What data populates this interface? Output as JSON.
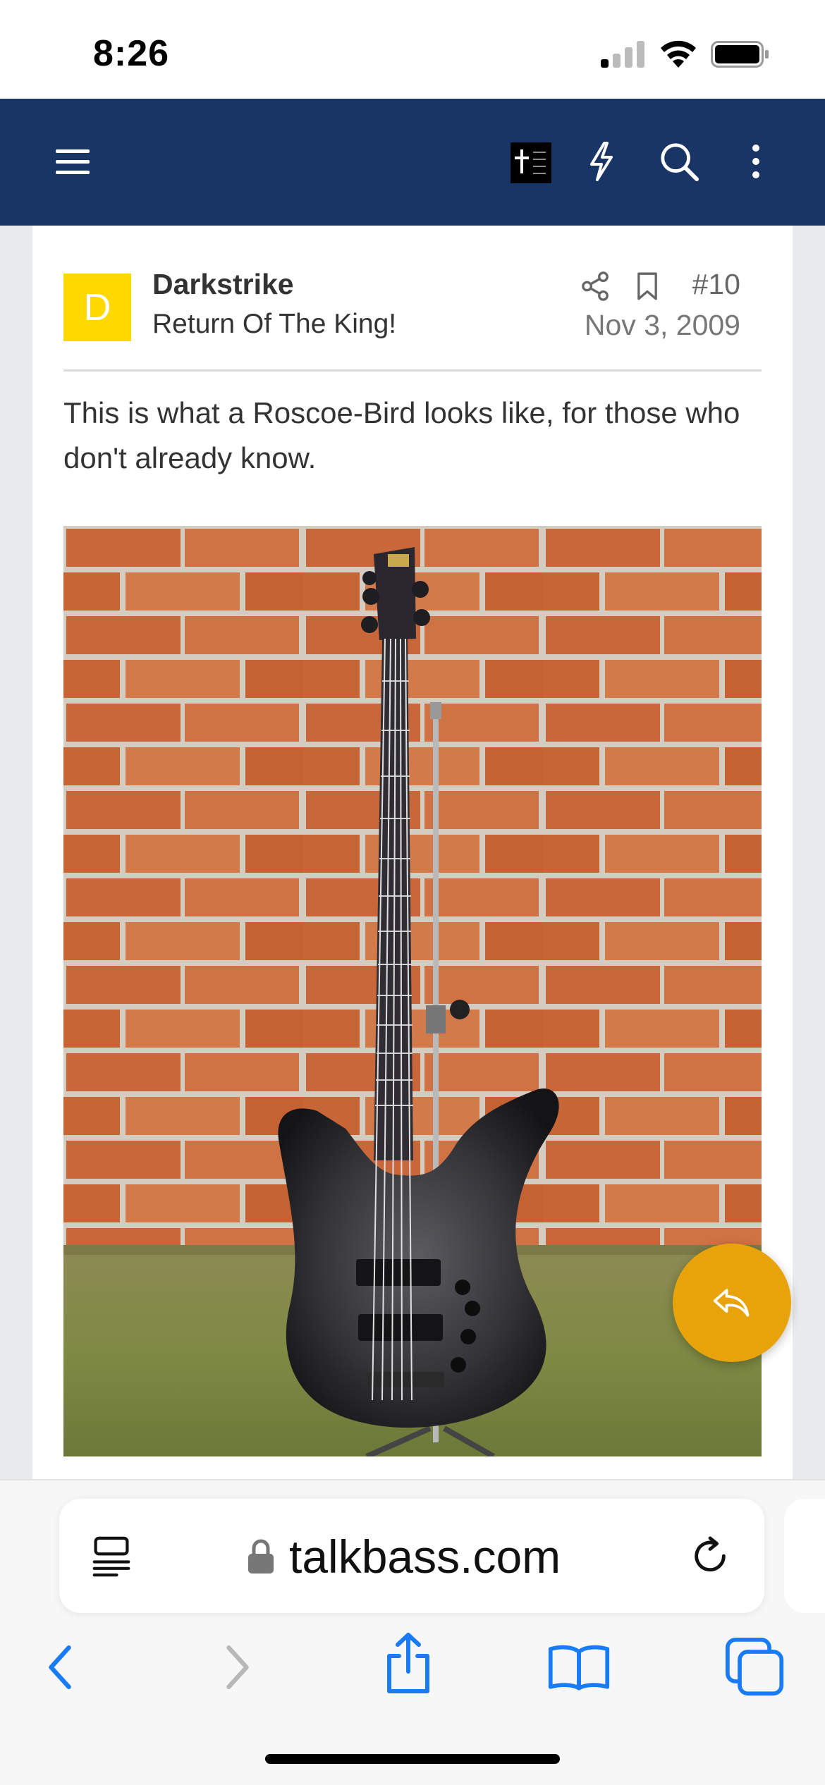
{
  "status_bar": {
    "time": "8:26"
  },
  "nav": {
    "icons": [
      "menu-icon",
      "site-logo",
      "lightning-icon",
      "search-icon",
      "more-vertical-icon"
    ]
  },
  "post": {
    "avatar_letter": "D",
    "avatar_color": "#ffd800",
    "username": "Darkstrike",
    "user_title": "Return Of The King!",
    "post_number": "#10",
    "date": "Nov 3, 2009",
    "text": "This is what a Roscoe-Bird looks like, for those who don't already know."
  },
  "browser": {
    "url": "talkbass.com"
  },
  "colors": {
    "nav_bg": "#183565",
    "reply_fab": "#e8a30a",
    "safari_blue": "#1a7cf5"
  }
}
